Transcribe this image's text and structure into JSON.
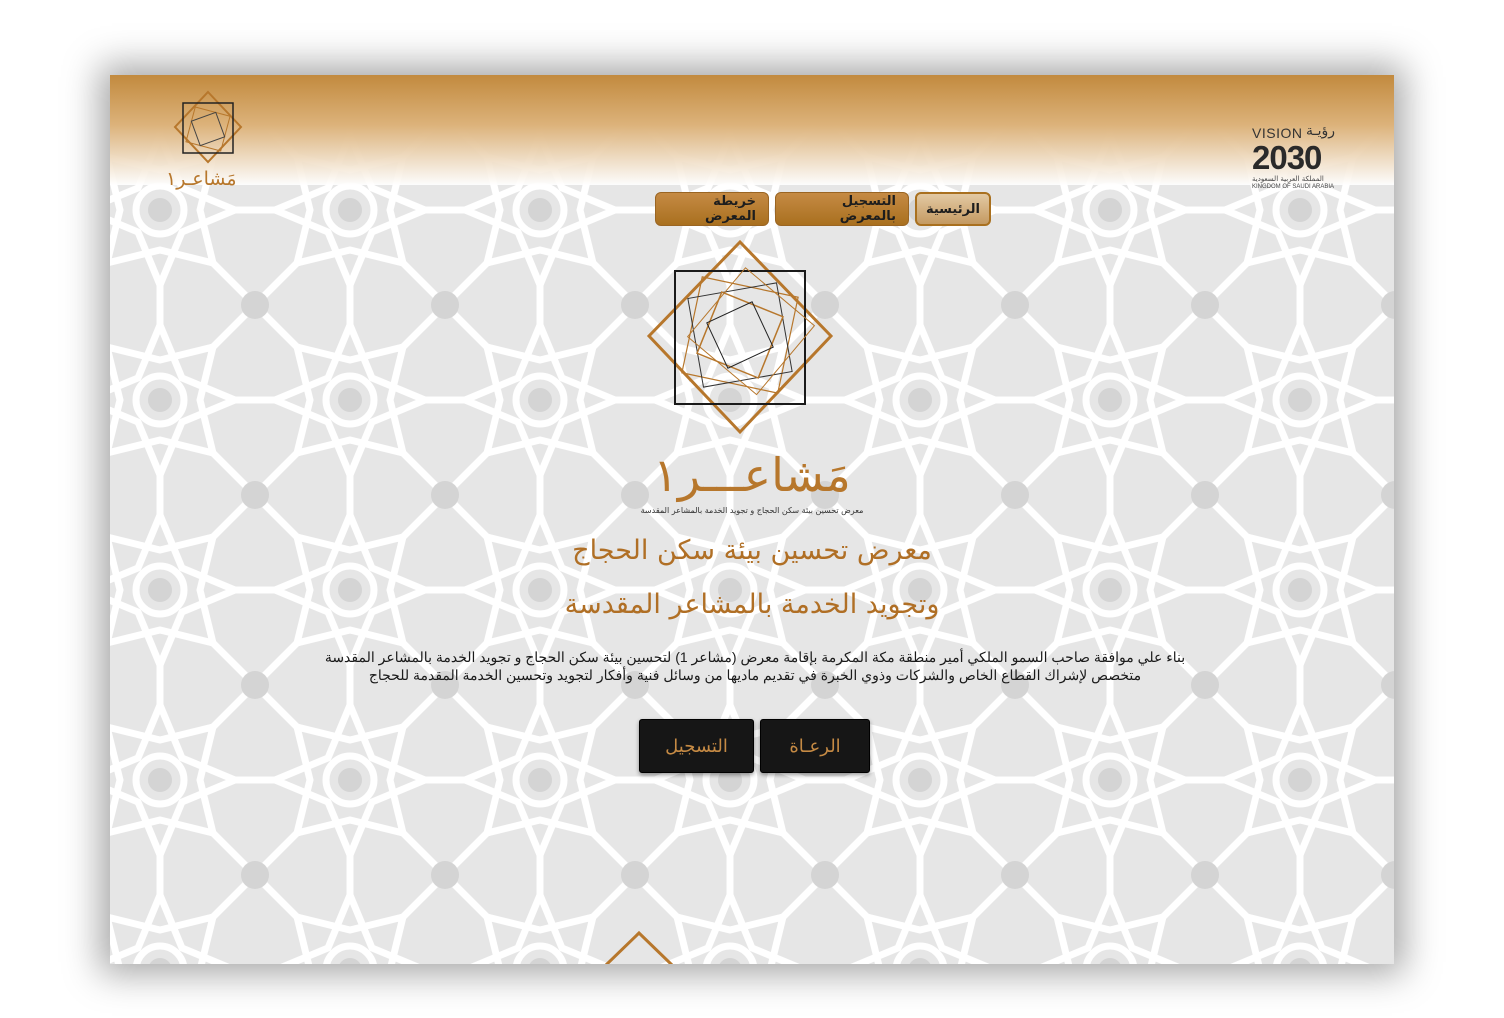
{
  "colors": {
    "accent": "#b7772c",
    "dark_button": "#161616",
    "pattern_bg": "#eeeeee"
  },
  "header": {
    "vision": {
      "word": "VISION",
      "arabic": "رؤيـة",
      "year": "2030",
      "arabic_small": "المملكة العربية السعودية",
      "english_small": "KINGDOM OF SAUDI ARABIA"
    },
    "small_logo_text": "مَشاعـر١"
  },
  "nav": {
    "items": [
      {
        "label": "الرئيسية",
        "active": true
      },
      {
        "label": "التسجيل بالمعرض",
        "active": false
      },
      {
        "label": "خريطة المعرض",
        "active": false
      }
    ]
  },
  "hero": {
    "brand_name": "مَشاعـــر١",
    "brand_sub": "معرض تحسين بيئة سكن الحجاج و تجويد الخدمة بالمشاعر المقدسة",
    "title_line1": "معرض تحسين بيئة سكن الحجاج",
    "title_line2": "وتجويد الخدمة بالمشاعر المقدسة",
    "description_line1": "بناء علي موافقة صاحب السمو الملكي أمير منطقة مكة المكرمة بإقامة معرض (مشاعر 1) لتحسين بيئة سكن الحجاج و تجويد الخدمة بالمشاعر المقدسة",
    "description_line2": "متخصص لإشراك القطاع الخاص والشركات وذوي الخبرة في تقديم ماديها من وسائل فنية وأفكار لتجويد وتحسين الخدمة المقدمة للحجاج"
  },
  "cta": {
    "sponsors_label": "الرعـاة",
    "register_label": "التسجيل"
  }
}
